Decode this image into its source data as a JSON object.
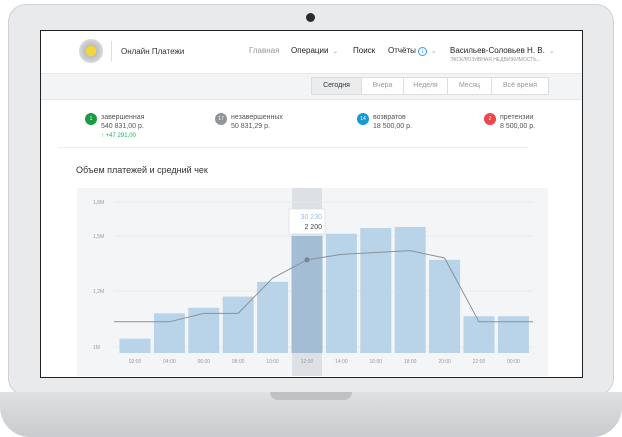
{
  "header": {
    "app_title": "Онлайн Платежи",
    "nav": [
      {
        "label": "Главная",
        "active": true
      },
      {
        "label": "Операции",
        "dropdown": true
      },
      {
        "label": "Поиск"
      },
      {
        "label": "Отчёты",
        "badge_icon": "info-icon",
        "dropdown": true
      }
    ],
    "user": {
      "name": "Васильев-Соловьев Н. В.",
      "company": "ЭКСКЛЮЗИВНАЯ НЕДВИЖИМОСТЬ..."
    }
  },
  "periods": [
    {
      "label": "Сегодня",
      "active": true
    },
    {
      "label": "Вчера"
    },
    {
      "label": "Неделя"
    },
    {
      "label": "Месяц"
    },
    {
      "label": "Всё время"
    }
  ],
  "stats": [
    {
      "count": "1",
      "label": "завершенная",
      "amount": "540 831,00 р.",
      "delta": "+47 291,00",
      "color": "#1a9c45"
    },
    {
      "count": "17",
      "label": "незавершенных",
      "amount": "50 831,29 р.",
      "color": "#8f959b"
    },
    {
      "count": "14",
      "label": "возвратов",
      "amount": "18 500,00 р.",
      "color": "#1899d6"
    },
    {
      "count": "2",
      "label": "претензии",
      "amount": "8 500,00 р.",
      "color": "#f0454a"
    }
  ],
  "chart_data": {
    "type": "bar",
    "title": "Объем платежей и средний чек",
    "categories": [
      "02:00",
      "04:00",
      "06:00",
      "08:00",
      "10:00",
      "12:00",
      "14:00",
      "16:00",
      "18:00",
      "20:00",
      "22:00",
      "00:00"
    ],
    "y_ticks": [
      "1M",
      "1,2M",
      "1,5M",
      "1,8M"
    ],
    "y_tick_values": [
      1.0,
      1.2,
      1.5,
      1.8
    ],
    "grid": true,
    "series": [
      {
        "type": "bar",
        "values": [
          1.03,
          1.12,
          1.14,
          1.18,
          1.25,
          1.5,
          1.52,
          1.57,
          1.58,
          1.37,
          1.11,
          1.11
        ],
        "color": "#b9d3e8"
      },
      {
        "type": "line",
        "values": [
          1.09,
          1.09,
          1.12,
          1.12,
          1.27,
          1.37,
          1.4,
          1.41,
          1.42,
          1.38,
          1.09,
          1.09
        ],
        "color": "#8a9299"
      }
    ],
    "highlight": {
      "category": "12:00",
      "tooltip": [
        "30 230",
        "2 200"
      ]
    }
  }
}
